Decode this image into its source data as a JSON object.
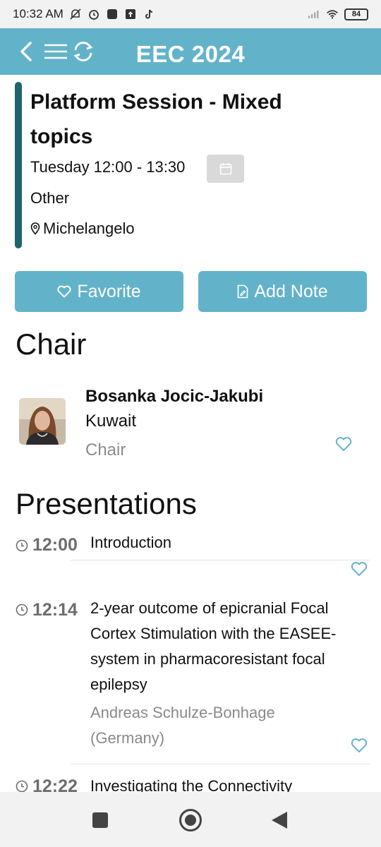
{
  "status_bar": {
    "time": "10:32 AM",
    "battery": "84"
  },
  "header": {
    "title": "EEC 2024"
  },
  "session": {
    "title": "Platform Session - Mixed topics",
    "time": "Tuesday 12:00 - 13:30",
    "type": "Other",
    "location": "Michelangelo"
  },
  "actions": {
    "favorite_label": "Favorite",
    "add_note_label": "Add Note"
  },
  "chair_section": {
    "heading": "Chair",
    "name": "Bosanka Jocic-Jakubi",
    "country": "Kuwait",
    "role": "Chair"
  },
  "presentations_section": {
    "heading": "Presentations",
    "items": [
      {
        "time": "12:00",
        "title": "Introduction",
        "author": ""
      },
      {
        "time": "12:14",
        "title": "2-year outcome of epicranial Focal Cortex Stimulation with the EASEE-system in pharmacoresistant focal epilepsy",
        "author": "Andreas Schulze-Bonhage (Germany)"
      },
      {
        "time": "12:22",
        "title": "Investigating the Connectivity",
        "author": ""
      }
    ]
  },
  "colors": {
    "accent": "#62b3c9",
    "accent_dark": "#1e6571",
    "muted_text": "#8a8a8a"
  },
  "icons": [
    "back-icon",
    "menu-icon",
    "refresh-icon",
    "calendar-icon",
    "location-pin-icon",
    "heart-icon",
    "note-icon",
    "clock-icon"
  ]
}
